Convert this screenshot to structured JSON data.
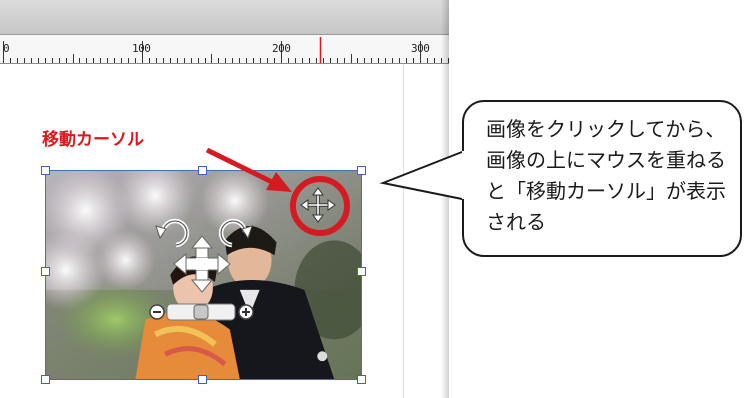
{
  "ruler": {
    "labels": [
      "0",
      "100",
      "200",
      "300"
    ]
  },
  "annotation": {
    "label": "移動カーソル",
    "color": "#e2141b"
  },
  "callout": {
    "text": "画像をクリックしてから、画像の上にマウスを重ねると「移動カーソル」が表示される"
  },
  "image_controls": {
    "rotate_left_icon": "rotate-left-icon",
    "rotate_right_icon": "rotate-right-icon",
    "move_cross_icon": "move-cross-icon",
    "zoom_out_icon": "zoom-out-icon",
    "zoom_in_icon": "zoom-in-icon",
    "zoom_slider_level": 0.5
  },
  "colors": {
    "selection": "#3a62c7",
    "accent_red": "#e2141b",
    "ruler_marker": "#e2141b"
  }
}
